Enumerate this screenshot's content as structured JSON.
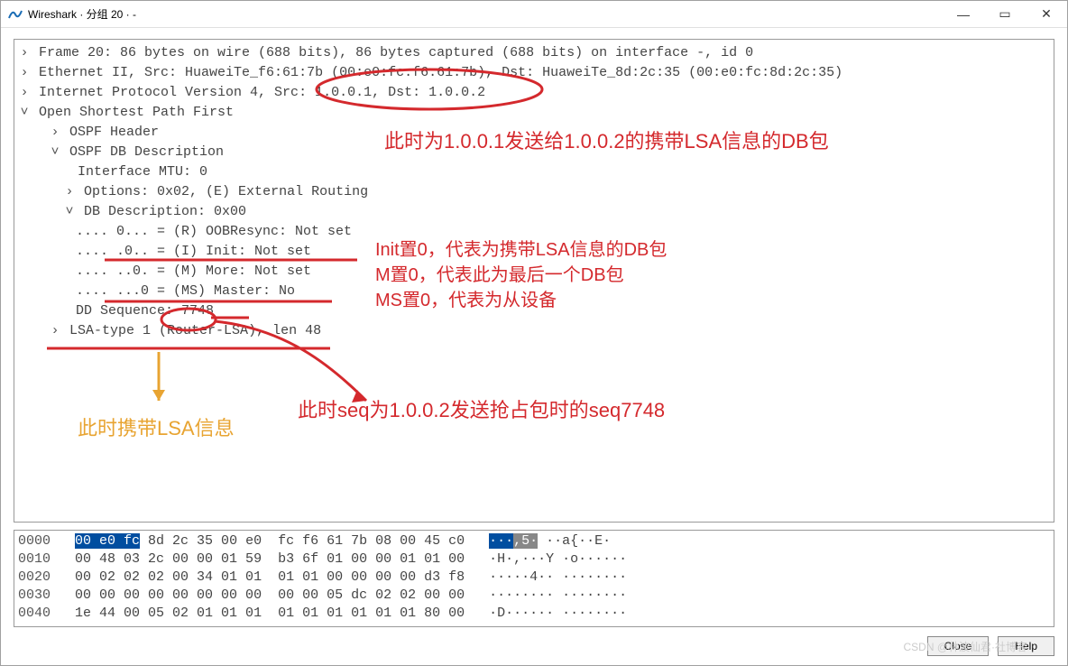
{
  "window": {
    "title": "Wireshark · 分组 20 · -"
  },
  "tree": {
    "frame": "Frame 20: 86 bytes on wire (688 bits), 86 bytes captured (688 bits) on interface -, id 0",
    "eth": "Ethernet II, Src: HuaweiTe_f6:61:7b (00:e0:fc:f6:61:7b), Dst: HuaweiTe_8d:2c:35 (00:e0:fc:8d:2c:35)",
    "ip_full": "Internet Protocol Version 4, Src: 1.0.0.1, Dst: 1.0.0.2",
    "ip_pre": "Internet Protocol Version 4, Src: ",
    "ip_mid": "1.0.0.1, Dst: 1.0.0.2",
    "ospf": "Open Shortest Path First",
    "ospf_header": "OSPF Header",
    "dbdesc": "OSPF DB Description",
    "mtu": "Interface MTU: 0",
    "options": "Options: 0x02, (E) External Routing",
    "dbd": "DB Description: 0x00",
    "r": ".... 0... = (R) OOBResync: Not set",
    "i": ".... .0.. = (I) Init: Not set",
    "m": ".... ..0. = (M) More: Not set",
    "ms": ".... ...0 = (MS) Master: No",
    "dd": "DD Sequence: 7748",
    "lsa": "LSA-type 1 (Router-LSA), len 48"
  },
  "hex": {
    "rows": [
      {
        "off": "0000",
        "hex_pre": "",
        "hex_hl": "00 e0 fc",
        "hex_post": " 8d 2c 35 00 e0  fc f6 61 7b 08 00 45 c0",
        "asc_hl": "···",
        "asc_hlg": ",5·",
        "asc_post": " ··a{··E·"
      },
      {
        "off": "0010",
        "hex": "00 48 03 2c 00 00 01 59  b3 6f 01 00 00 01 01 00",
        "asc": "·H·,···Y ·o······"
      },
      {
        "off": "0020",
        "hex": "00 02 02 02 00 34 01 01  01 01 00 00 00 00 d3 f8",
        "asc": "·····4·· ········"
      },
      {
        "off": "0030",
        "hex": "00 00 00 00 00 00 00 00  00 00 05 dc 02 02 00 00",
        "asc": "········ ········"
      },
      {
        "off": "0040",
        "hex": "1e 44 00 05 02 01 01 01  01 01 01 01 01 01 80 00",
        "asc": "·D······ ········"
      }
    ]
  },
  "buttons": {
    "close": "Close",
    "help": "Help"
  },
  "watermark": "CSDN @林波仙君·社博客",
  "annotations": {
    "a1": "此时为1.0.0.1发送给1.0.0.2的携带LSA信息的DB包",
    "a2a": "Init置0，代表为携带LSA信息的DB包",
    "a2b": "M置0，代表此为最后一个DB包",
    "a2c": "MS置0，代表为从设备",
    "a3": "此时seq为1.0.0.2发送抢占包时的seq7748",
    "a4": "此时携带LSA信息"
  }
}
